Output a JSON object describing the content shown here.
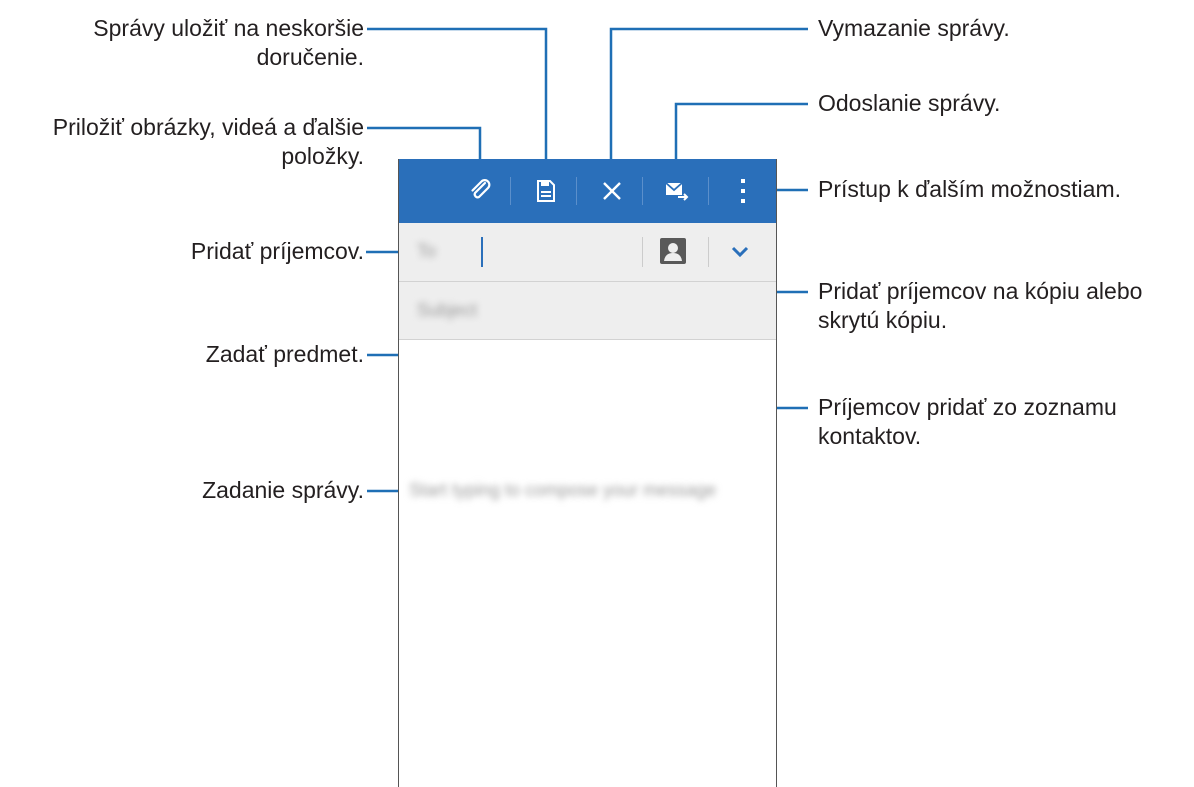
{
  "annotations": {
    "save_line1": "Správy uložiť na neskoršie",
    "save_line2": "doručenie.",
    "attach_line1": "Priložiť obrázky, videá a ďalšie",
    "attach_line2": "položky.",
    "add_recipients": "Pridať príjemcov.",
    "subject": "Zadať predmet.",
    "body": "Zadanie správy.",
    "delete": "Vymazanie správy.",
    "send": "Odoslanie správy.",
    "more": "Prístup k ďalším možnostiam.",
    "cc_line1": "Pridať príjemcov na kópiu alebo",
    "cc_line2": "skrytú kópiu.",
    "contacts_line1": "Príjemcov pridať zo zoznamu",
    "contacts_line2": "kontaktov."
  },
  "compose": {
    "to_label": "To",
    "subject_placeholder": "Subject",
    "body_placeholder": "Start typing to compose your message"
  },
  "colors": {
    "actionbar": "#2a6fba",
    "leader_line": "#1f6fb5",
    "field_bg": "#eeeeee"
  },
  "icons": [
    "paperclip-icon",
    "save-icon",
    "close-icon",
    "send-icon",
    "overflow-menu-icon",
    "contact-icon",
    "chevron-down-icon"
  ]
}
